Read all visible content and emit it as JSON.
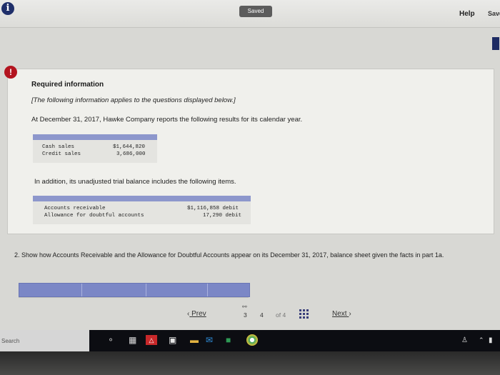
{
  "toolbar": {
    "saved_label": "Saved",
    "help_label": "Help",
    "save_label": "Save"
  },
  "info": {
    "title": "Required information",
    "note": "[The following information applies to the questions displayed below.]",
    "intro": "At December 31, 2017, Hawke Company reports the following results for its calendar year.",
    "sales_table": [
      {
        "label": "Cash sales",
        "value": "$1,644,820"
      },
      {
        "label": "Credit sales",
        "value": "3,686,000"
      }
    ],
    "additional": "In addition, its unadjusted trial balance includes the following items.",
    "balance_table": [
      {
        "label": "Accounts receivable",
        "value": "$1,116,858 debit"
      },
      {
        "label": "Allowance for doubtful accounts",
        "value": "17,290 debit"
      }
    ]
  },
  "question": {
    "text": "2. Show how Accounts Receivable and the Allowance for Doubtful Accounts appear on its December 31, 2017, balance sheet given the facts in part 1a."
  },
  "pagination": {
    "prev_label": "Prev",
    "prev_page": "3",
    "current_page": "4",
    "total": "of 4",
    "next_label": "Next"
  },
  "taskbar": {
    "search_label": "Search"
  }
}
